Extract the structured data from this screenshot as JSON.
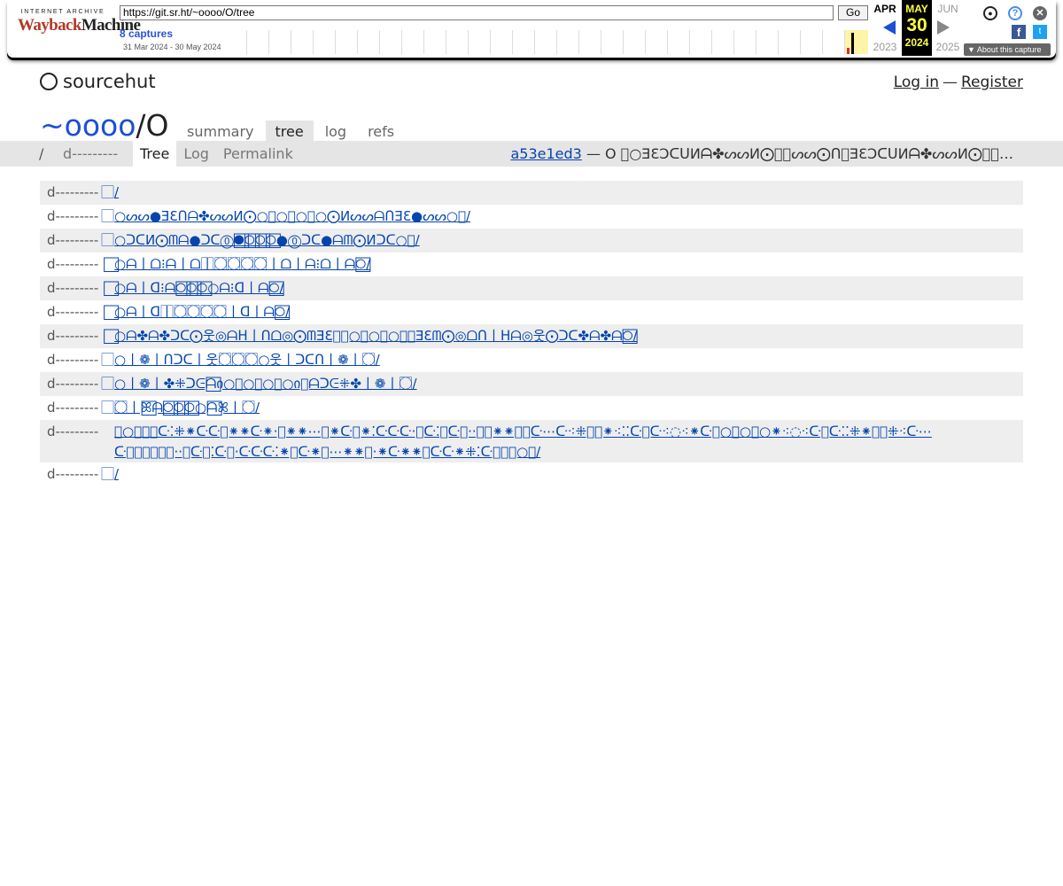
{
  "wayback": {
    "logo_top": "INTERNET ARCHIVE",
    "logo_wayback": "Wayback",
    "logo_machine": "Machine",
    "url": "https://git.sr.ht/~oooo/O/tree",
    "go_label": "Go",
    "captures_label": "8 captures",
    "date_range": "31 Mar 2024 - 30 May 2024",
    "prev_month": "APR",
    "current_month": "MAY",
    "current_day": "30",
    "current_year": "2024",
    "next_month": "JUN",
    "prev_year": "2023",
    "next_year": "2025",
    "about_label": "About this capture",
    "fb_label": "f",
    "tw_label": "t"
  },
  "site": {
    "brand": "sourcehut",
    "login": "Log in",
    "dash": "—",
    "register": "Register"
  },
  "repo": {
    "owner": "~oooo",
    "separator": "/",
    "name": "O",
    "tabs": [
      "summary",
      "tree",
      "log",
      "refs"
    ],
    "active_tab": "tree"
  },
  "subnav": {
    "path": "/",
    "mode": "d---------",
    "tabs": [
      "Tree",
      "Log",
      "Permalink"
    ],
    "commit_hash": "a53e1ed3",
    "commit_message": "— O ⃞○ƎƐƆᑕᑌИᗩ✤ᔕᔕИ⨀⃞⃞ᔕᔕ⨀ᑎ⃞ƎƐƆᑕᑌИᗩ✤ᔕᔕИ⨀⃞⃞…"
  },
  "tree": {
    "rows": [
      {
        "mode": "d---------",
        "name": "⃞/"
      },
      {
        "mode": "d---------",
        "name": "⃞○ᔕᔕ●ƎƐᑎᗩ✤ᔕᔕИ⨀○⃞○⃞○⃞○⨀ИᔕᔕᗩᑎƎƐ●ᔕᔕ○⃞/"
      },
      {
        "mode": "d---------",
        "name": "⃞○ᑐᑕИ⨀ᗰᗩ●ᑐᑕ⓪●⃞○⃞○⃞○⃞●⓪ᑐᑕ●ᗩᗰ⨀Иᑐᑕ○⃞/"
      },
      {
        "mode": "d---------",
        "name": "⃞○ᗩ丨ᗝ⁝ᗩ丨ᗝ丨⃞○⃞○⃞○⃞○⃞丨ᗝ丨ᗩ⁝ᗝ丨ᗩ○⃞/"
      },
      {
        "mode": "d---------",
        "name": "⃞○ᗩ丨ᗡ⁝ᗩ○⃞○⃞○⃞○ᗩ⁝ᗡ丨ᗩ○⃞/"
      },
      {
        "mode": "d---------",
        "name": "⃞○ᗩ丨ᗡ丨⃞○⃞○⃞○⃞○⃞丨ᗡ丨ᗩ○⃞/"
      },
      {
        "mode": "d---------",
        "name": "⃞○ᗩ✤ᗩ✤ᑐᑕ⨀웃◎ᗩᕼ丨ᑎᗝ◎⨀ᗰƎƐ⃞⃞○⃞○⃞○⃞⃞ƎƐᗰ⨀◎ᗝᑎ丨ᕼᗩ◎웃⨀ᑐᑕ✤ᗩ✤ᗩ○⃞/"
      },
      {
        "mode": "d---------",
        "name": "⃞○丨❁丨ᑎᑐᑕ丨웃○⃞○⃞○⃞○웃丨ᑐᑕᑎ丨❁丨○⃞/"
      },
      {
        "mode": "d---------",
        "name": "⃞○丨❁丨✤⁜ᑐᕮᗩ⃞ი○⃞○⃞○⃞○ი⃞ᗩᑐᕮ⁜✤丨❁丨○⃞/"
      },
      {
        "mode": "d---------",
        "name": "⃞○⃞丨ꕤ⃞ᗩ○⃞○⃞○⃞○ᗩ⃞ꕤ丨○⃞/"
      },
      {
        "mode": "d---------",
        "name": "⃞○⃞⃞⃞ᑢ⁚⁜⁕ᑢᑢ⃞⁕⁕ᑢ⁕·⃞⁕⁕⋯⃞⁕ᑢ⃞⁕⁚ᑢᑢᑢ·⃞ᑢ⁚⃞ᑢ⃞··⃞⃞⁕⁕⃞⃞ᑢ⋯ᑢ⁖⁜⃞⃞⁕⁖⁚⁚ᑢ⃞ᑢ⁖◌⁖⁕ᑢ⃞○⃞○⃞○⁕⁖◌⁖ᑢ⃞ᑢ⁚⁚⁜⁕⃞⃞⁜⁖ᑢ⋯ᑢ⃞⃞⃞⃞⃞⃞··⃞ᑢ⃞⁚ᑢ⃞·ᑢᑢᑢ⁚⁕⃞ᑢ⁕⃞⋯⁕⁕⃞·⁕ᑢ⁕⁕⃞ᑢᑢ⁕⁜⁚ᑢ⃞⃞⃞○⃞/"
      },
      {
        "mode": "d---------",
        "name": "⃞/"
      }
    ]
  }
}
